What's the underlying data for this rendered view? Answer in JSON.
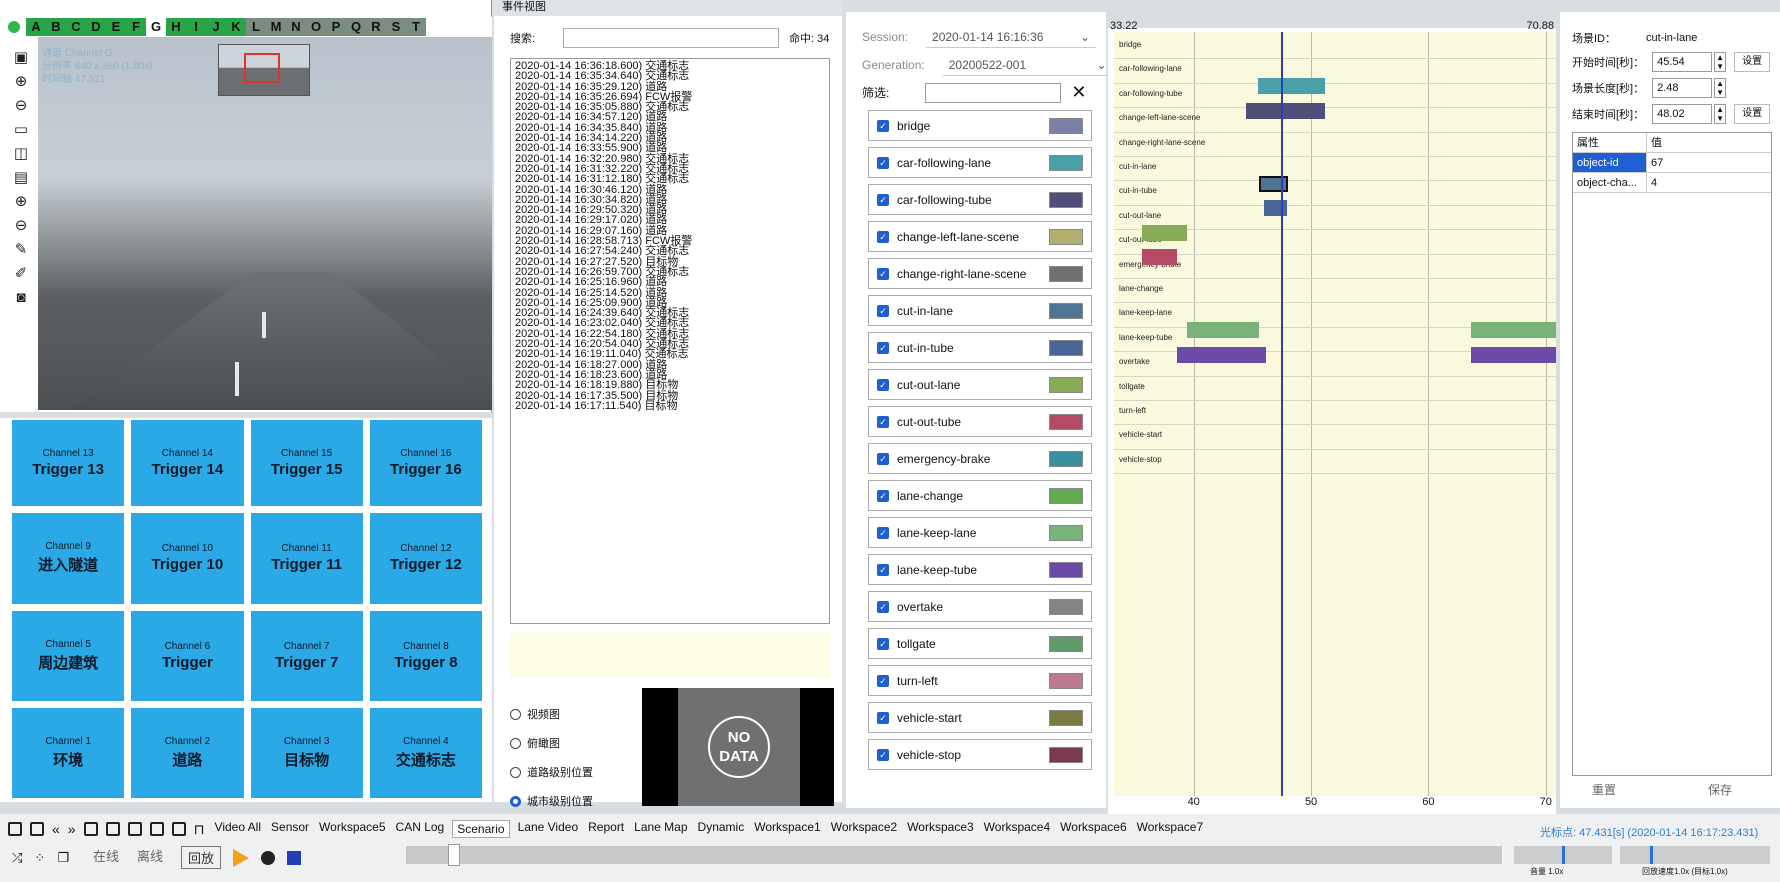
{
  "video": {
    "letters": [
      "A",
      "B",
      "C",
      "D",
      "E",
      "F",
      "G",
      "H",
      "I",
      "J",
      "K",
      "L",
      "M",
      "N",
      "O",
      "P",
      "Q",
      "R",
      "S",
      "T"
    ],
    "selected_letter": "G",
    "dark_letters": [
      "L",
      "M",
      "N",
      "O",
      "P",
      "Q",
      "R",
      "S",
      "T"
    ],
    "info": {
      "channel": "通道 Channel G",
      "resolution": "分辨率 640 x 360 (1.80x)",
      "timestamp": "时间轴 47.521"
    }
  },
  "triggers": [
    {
      "ch": "Channel 13",
      "tg": "Trigger 13"
    },
    {
      "ch": "Channel 14",
      "tg": "Trigger 14"
    },
    {
      "ch": "Channel 15",
      "tg": "Trigger 15"
    },
    {
      "ch": "Channel 16",
      "tg": "Trigger 16"
    },
    {
      "ch": "Channel 9",
      "tg": "进入隧道"
    },
    {
      "ch": "Channel 10",
      "tg": "Trigger 10"
    },
    {
      "ch": "Channel 11",
      "tg": "Trigger 11"
    },
    {
      "ch": "Channel 12",
      "tg": "Trigger 12"
    },
    {
      "ch": "Channel 5",
      "tg": "周边建筑"
    },
    {
      "ch": "Channel 6",
      "tg": "Trigger"
    },
    {
      "ch": "Channel 7",
      "tg": "Trigger 7"
    },
    {
      "ch": "Channel 8",
      "tg": "Trigger 8"
    },
    {
      "ch": "Channel 1",
      "tg": "环境"
    },
    {
      "ch": "Channel 2",
      "tg": "道路"
    },
    {
      "ch": "Channel 3",
      "tg": "目标物"
    },
    {
      "ch": "Channel 4",
      "tg": "交通标志"
    }
  ],
  "events": {
    "title": "事件视图",
    "search_label": "搜索:",
    "hits": "命中: 34",
    "items": [
      "2020-01-14 16:36:18.600) 交通标志",
      "2020-01-14 16:35:34.640) 交通标志",
      "2020-01-14 16:35:29.120) 道路",
      "2020-01-14 16:35:26.694) FCW报警",
      "2020-01-14 16:35:05.880) 交通标志",
      "2020-01-14 16:34:57.120) 道路",
      "2020-01-14 16:34:35.840) 道路",
      "2020-01-14 16:34:14.220) 道路",
      "2020-01-14 16:33:55.900) 道路",
      "2020-01-14 16:32:20.980) 交通标志",
      "2020-01-14 16:31:32.220) 交通标志",
      "2020-01-14 16:31:12.180) 交通标志",
      "2020-01-14 16:30:46.120) 道路",
      "2020-01-14 16:30:34.820) 道路",
      "2020-01-14 16:29:50.320) 道路",
      "2020-01-14 16:29:17.020) 道路",
      "2020-01-14 16:29:07.160) 道路",
      "2020-01-14 16:28:58.713) FCW报警",
      "2020-01-14 16:27:54.240) 交通标志",
      "2020-01-14 16:27:27.520) 目标物",
      "2020-01-14 16:26:59.700) 交通标志",
      "2020-01-14 16:25:16.960) 道路",
      "2020-01-14 16:25:14.520) 道路",
      "2020-01-14 16:25:09.900) 道路",
      "2020-01-14 16:24:39.640) 交通标志",
      "2020-01-14 16:23:02.040) 交通标志",
      "2020-01-14 16:22:54.180) 交通标志",
      "2020-01-14 16:20:54.040) 交通标志",
      "2020-01-14 16:19:11.040) 交通标志",
      "2020-01-14 16:18:27.000) 道路",
      "2020-01-14 16:18:23.600) 道路",
      "2020-01-14 16:18:19.880) 目标物",
      "2020-01-14 16:17:35.500) 目标物",
      "2020-01-14 16:17:11.540) 目标物"
    ],
    "radios": [
      {
        "label": "视频图",
        "on": false
      },
      {
        "label": "俯瞰图",
        "on": false
      },
      {
        "label": "道路级别位置",
        "on": false
      },
      {
        "label": "城市级别位置",
        "on": true
      }
    ],
    "nodata": "NO DATA"
  },
  "scenario": {
    "session_label": "Session:",
    "session": "2020-01-14 16:16:36",
    "generation_label": "Generation:",
    "generation": "20200522-001",
    "filter_label": "筛选:",
    "tags": [
      {
        "name": "bridge",
        "color": "#7b80a8"
      },
      {
        "name": "car-following-lane",
        "color": "#4aa0a8"
      },
      {
        "name": "car-following-tube",
        "color": "#4f4f7a"
      },
      {
        "name": "change-left-lane-scene",
        "color": "#b1b06e"
      },
      {
        "name": "change-right-lane-scene",
        "color": "#6f7170"
      },
      {
        "name": "cut-in-lane",
        "color": "#4f7496"
      },
      {
        "name": "cut-in-tube",
        "color": "#4a6698"
      },
      {
        "name": "cut-out-lane",
        "color": "#88ab58"
      },
      {
        "name": "cut-out-tube",
        "color": "#b44a63"
      },
      {
        "name": "emergency-brake",
        "color": "#3b8e9e"
      },
      {
        "name": "lane-change",
        "color": "#66a955"
      },
      {
        "name": "lane-keep-lane",
        "color": "#79b37a"
      },
      {
        "name": "lane-keep-tube",
        "color": "#6b4aa8"
      },
      {
        "name": "overtake",
        "color": "#848484"
      },
      {
        "name": "tollgate",
        "color": "#5e9a6a"
      },
      {
        "name": "turn-left",
        "color": "#bb7a8d"
      },
      {
        "name": "vehicle-start",
        "color": "#7c7a44"
      },
      {
        "name": "vehicle-stop",
        "color": "#7b3a4e"
      }
    ]
  },
  "timeline": {
    "xmin": "33.22",
    "xmax": "70.88",
    "ticks": [
      "40",
      "50",
      "60",
      "70"
    ],
    "rows": [
      "bridge",
      "car-following-lane",
      "car-following-tube",
      "change-left-lane-scene",
      "change-right-lane-scene",
      "cut-in-lane",
      "cut-in-tube",
      "cut-out-lane",
      "cut-out-tube",
      "emergency-brake",
      "lane-change",
      "lane-keep-lane",
      "lane-keep-tube",
      "overtake",
      "tollgate",
      "turn-left",
      "vehicle-start",
      "vehicle-stop"
    ],
    "bars": [
      {
        "row": 1,
        "start": 45.5,
        "end": 51.2,
        "color": "#4aa0a8"
      },
      {
        "row": 2,
        "start": 44.5,
        "end": 51.2,
        "color": "#4f4f7a"
      },
      {
        "row": 5,
        "start": 45.54,
        "end": 48.02,
        "color": "#4f7496"
      },
      {
        "row": 6,
        "start": 46.0,
        "end": 48.0,
        "color": "#4a6698"
      },
      {
        "row": 7,
        "start": 35.6,
        "end": 39.4,
        "color": "#88ab58"
      },
      {
        "row": 8,
        "start": 35.6,
        "end": 38.6,
        "color": "#b44a63"
      },
      {
        "row": 11,
        "start": 39.4,
        "end": 45.6,
        "color": "#79b37a"
      },
      {
        "row": 11,
        "start": 63.6,
        "end": 70.88,
        "color": "#79b37a"
      },
      {
        "row": 12,
        "start": 38.6,
        "end": 46.2,
        "color": "#6b4aa8"
      },
      {
        "row": 12,
        "start": 63.6,
        "end": 70.88,
        "color": "#6b4aa8"
      }
    ],
    "cursor": 47.431
  },
  "props": {
    "scene_id_label": "场景ID：",
    "scene_id": "cut-in-lane",
    "start_label": "开始时间[秒]：",
    "start": "45.54",
    "len_label": "场景长度[秒]：",
    "len": "2.48",
    "end_label": "结束时间[秒]：",
    "end": "48.02",
    "set": "设置",
    "col_key": "属性",
    "col_val": "值",
    "rows": [
      {
        "k": "object-id",
        "v": "67"
      },
      {
        "k": "object-cha...",
        "v": "4"
      }
    ],
    "reset": "重置",
    "save": "保存"
  },
  "bottom": {
    "tabs": [
      "Video All",
      "Sensor",
      "Workspace5",
      "CAN Log",
      "Scenario",
      "Lane Video",
      "Report",
      "Lane Map",
      "Dynamic",
      "Workspace1",
      "Workspace2",
      "Workspace3",
      "Workspace4",
      "Workspace6",
      "Workspace7"
    ],
    "active_tab": "Scenario",
    "cursor_readout": "光标点: 47.431[s] (2020-01-14 16:17:23.431)",
    "modes": [
      {
        "label": "在线",
        "active": false
      },
      {
        "label": "离线",
        "active": false
      },
      {
        "label": "回放",
        "active": true
      }
    ],
    "vol_label": "音量 1.0x",
    "speed_label": "回放速度1.0x (目标1.0x)"
  }
}
